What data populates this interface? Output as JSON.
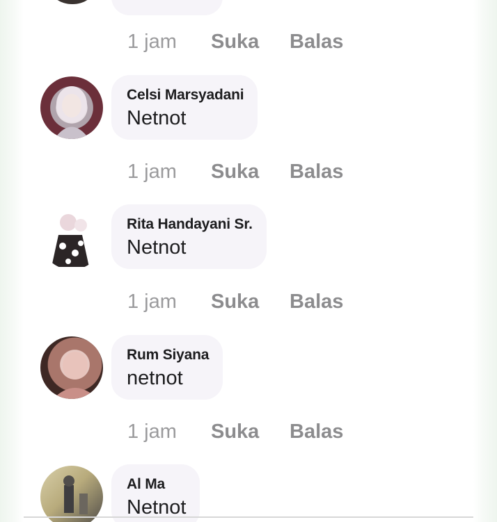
{
  "top_actions": {
    "time": "1 jam",
    "like": "Suka",
    "reply": "Balas"
  },
  "comments": [
    {
      "author": "Celsi Marsyadani",
      "text": "Netnot",
      "time": "1 jam",
      "like": "Suka",
      "reply": "Balas",
      "avatar": "profile-photo-hijab"
    },
    {
      "author": "Rita Handayani Sr.",
      "text": "Netnot",
      "time": "1 jam",
      "like": "Suka",
      "reply": "Balas",
      "avatar": "profile-photo-doll"
    },
    {
      "author": "Rum Siyana",
      "text": "netnot",
      "time": "1 jam",
      "like": "Suka",
      "reply": "Balas",
      "avatar": "profile-photo-baby"
    },
    {
      "author": "Al Ma",
      "text": "Netnot",
      "avatar": "profile-photo-group"
    }
  ],
  "colors": {
    "bubble": "#f6f4f9",
    "action_text": "#8b8b8d",
    "author_text": "#1c1c1e"
  }
}
